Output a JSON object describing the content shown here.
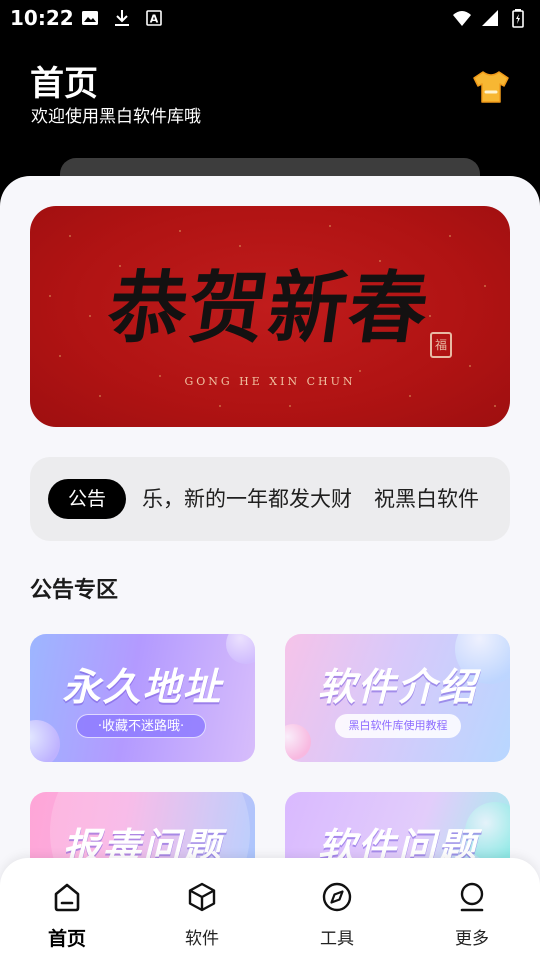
{
  "status_bar": {
    "time": "10:22",
    "left_icons": [
      "image-icon",
      "download-icon",
      "a-box-icon"
    ],
    "right_icons": [
      "wifi-icon",
      "signal-icon",
      "battery-icon"
    ]
  },
  "header": {
    "title": "首页",
    "subtitle": "欢迎使用黑白软件库哦",
    "action_icon": "tshirt-icon",
    "accent_color": "#f7b733"
  },
  "banner": {
    "title": "恭贺新春",
    "subtitle": "GONG HE XIN CHUN",
    "seal_text": "福",
    "background_color": "#b01313"
  },
  "notice": {
    "badge": "公告",
    "messages": [
      "乐，新的一年都发大财",
      "祝黑白软件"
    ]
  },
  "section": {
    "title": "公告专区"
  },
  "cards": [
    {
      "title": "永久地址",
      "caption": "·收藏不迷路哦·"
    },
    {
      "title": "软件介绍",
      "caption": "黑白软件库使用教程"
    },
    {
      "title": "报毒问题",
      "caption": ""
    },
    {
      "title": "软件问题",
      "caption": ""
    }
  ],
  "bottom_nav": {
    "items": [
      {
        "label": "首页",
        "icon": "home-icon",
        "active": true
      },
      {
        "label": "软件",
        "icon": "cube-icon",
        "active": false
      },
      {
        "label": "工具",
        "icon": "compass-icon",
        "active": false
      },
      {
        "label": "更多",
        "icon": "user-icon",
        "active": false
      }
    ]
  }
}
